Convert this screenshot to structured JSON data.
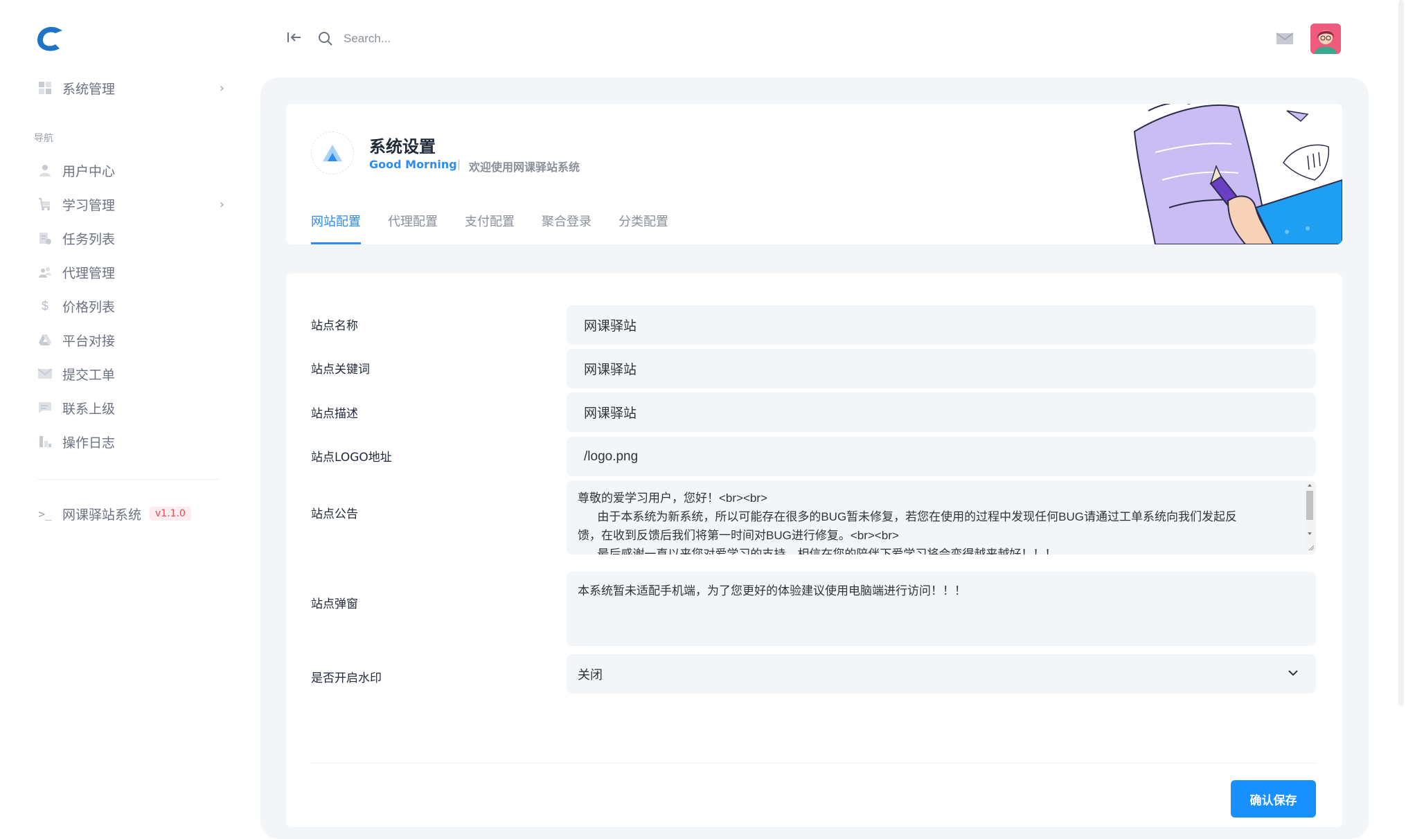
{
  "sidebar": {
    "items": [
      {
        "label": "系统管理",
        "icon": "grid-icon",
        "has_chevron": true
      },
      {
        "label": "用户中心",
        "icon": "user-icon"
      },
      {
        "label": "学习管理",
        "icon": "cart-icon",
        "has_chevron": true
      },
      {
        "label": "任务列表",
        "icon": "task-icon"
      },
      {
        "label": "代理管理",
        "icon": "users-icon"
      },
      {
        "label": "价格列表",
        "icon": "dollar-icon"
      },
      {
        "label": "平台对接",
        "icon": "platform-icon"
      },
      {
        "label": "提交工单",
        "icon": "mail-icon"
      },
      {
        "label": "联系上级",
        "icon": "chat-icon"
      },
      {
        "label": "操作日志",
        "icon": "chart-icon"
      }
    ],
    "section_label": "导航",
    "system_name": "网课驿站系统",
    "version": "v1.1.0"
  },
  "topbar": {
    "search_placeholder": "Search..."
  },
  "header": {
    "title": "系统设置",
    "greeting": "Good Morning",
    "separator": "|",
    "welcome": "欢迎使用网课驿站系统",
    "tabs": [
      {
        "label": "网站配置",
        "active": true
      },
      {
        "label": "代理配置",
        "active": false
      },
      {
        "label": "支付配置",
        "active": false
      },
      {
        "label": "聚合登录",
        "active": false
      },
      {
        "label": "分类配置",
        "active": false
      }
    ]
  },
  "form": {
    "site_name": {
      "label": "站点名称",
      "value": "网课驿站"
    },
    "site_keywords": {
      "label": "站点关键词",
      "value": "网课驿站"
    },
    "site_description": {
      "label": "站点描述",
      "value": "网课驿站"
    },
    "site_logo": {
      "label": "站点LOGO地址",
      "value": "/logo.png"
    },
    "site_notice": {
      "label": "站点公告",
      "line1": "尊敬的爱学习用户，您好！<br><br>",
      "line2": "      由于本系统为新系统，所以可能存在很多的BUG暂未修复，若您在使用的过程中发现任何BUG请通过工单系统向我们发起反",
      "line3": "馈，在收到反馈后我们将第一时间对BUG进行修复。<br><br>",
      "line4": "      最后感谢一直以来您对爱学习的支持，相信在您的陪伴下爱学习将会变得越来越好！！！"
    },
    "site_popup": {
      "label": "站点弹窗",
      "value": "本系统暂未适配手机端，为了您更好的体验建议使用电脑端进行访问！！！"
    },
    "watermark": {
      "label": "是否开启水印",
      "value": "关闭"
    },
    "save_label": "确认保存"
  },
  "colors": {
    "accent": "#2d8cf0",
    "save_button": "#1890ff",
    "version_text": "#e5484d"
  }
}
